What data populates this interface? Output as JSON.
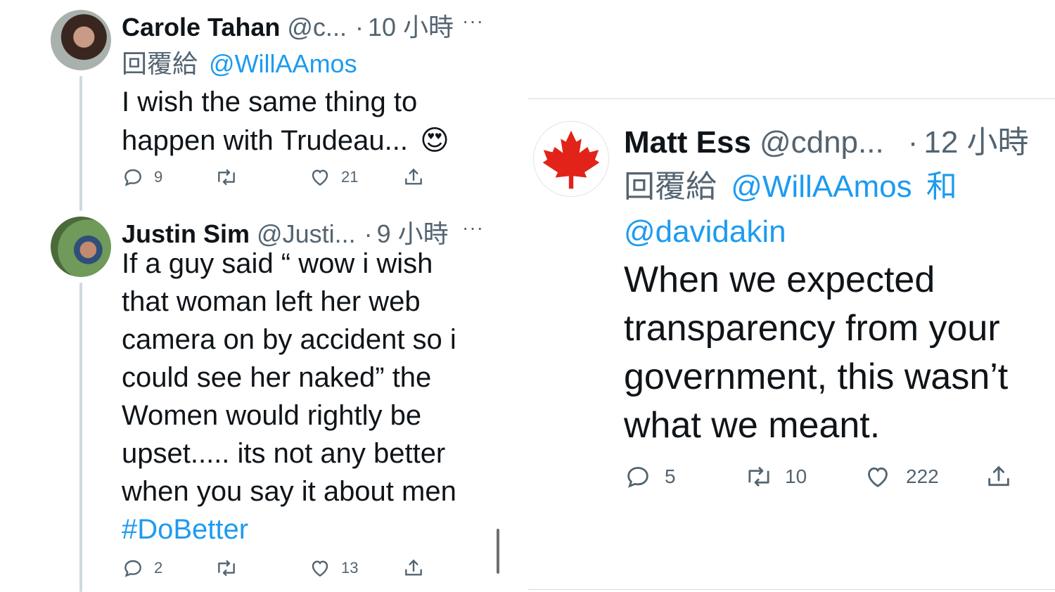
{
  "left": {
    "tweets": [
      {
        "name": "Carole Tahan",
        "handle": "@c...",
        "separator": "·",
        "time": "10 小時",
        "more": "···",
        "reply_prefix": "回覆給",
        "reply_mentions": [
          "@WillAAmos"
        ],
        "text_lines": [
          "I wish the same thing to",
          "happen with Trudeau..."
        ],
        "emoji": "😍",
        "actions": {
          "replies": "9",
          "retweets": "",
          "likes": "21"
        }
      },
      {
        "name": "Justin Sim",
        "handle": "@Justi...",
        "separator": "·",
        "time": "9 小時",
        "more": "···",
        "text_lines": [
          "If a guy said “ wow i wish",
          "that woman left her web",
          "camera on by accident so i",
          "could see her naked” the",
          "Women would rightly be",
          "upset..... its not any better",
          "when you say it about men"
        ],
        "hashtag": "#DoBetter",
        "actions": {
          "replies": "2",
          "retweets": "",
          "likes": "13"
        }
      }
    ]
  },
  "right": {
    "tweet": {
      "name": "Matt Ess",
      "handle": "@cdnp...",
      "separator": "·",
      "time": "12 小時",
      "reply_prefix": "回覆給",
      "reply_mentions": [
        "@WillAAmos",
        "@davidakin"
      ],
      "reply_conjunction": "和",
      "text_lines": [
        "When we expected",
        "transparency from your",
        "government, this wasn’t",
        "what we meant."
      ],
      "actions": {
        "replies": "5",
        "retweets": "10",
        "likes": "222"
      }
    }
  },
  "colors": {
    "link": "#1d9bf0",
    "muted": "#536471",
    "thread_line": "#cfd9de",
    "maple_red": "#e2231a"
  },
  "icons": [
    "reply-icon",
    "retweet-icon",
    "like-icon",
    "share-icon",
    "more-icon",
    "maple-leaf-icon"
  ]
}
